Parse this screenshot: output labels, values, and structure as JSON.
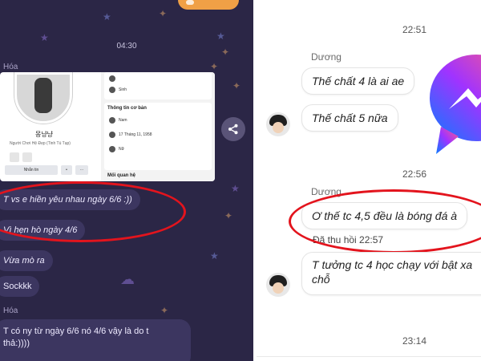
{
  "left_panel": {
    "timestamp": "04:30",
    "sender_top": "Hóa",
    "sender_bottom": "Hóa",
    "shared_card": {
      "name": "몽냥냥",
      "subtitle": "Người Chơi Hệ Đẹp (Tinh Tú Tạp)",
      "msg_button": "Nhắn tin",
      "side_label": "Sinh",
      "section_title": "Thông tin cơ bản",
      "rows": [
        "Nam",
        "17 Tháng 11, 1958",
        "Nữ"
      ],
      "section_more": "Mối quan hệ"
    },
    "messages": [
      "T vs e hiền yêu nhau ngày 6/6 :))",
      "Vì hẹn hò ngày 4/6",
      "Vừa mò ra",
      "Sockkk",
      "T có ny từ ngày 6/6 nó 4/6 vậy là do t",
      "thả:))))"
    ],
    "share_icon": "share-icon",
    "colors": {
      "background": "#2b2646",
      "bubble": "#3c3660",
      "annotation": "#e3141d"
    }
  },
  "right_panel": {
    "timestamps": [
      "22:51",
      "22:56",
      "23:14"
    ],
    "sender": "Dương",
    "messages": [
      "Thế chất 4 là ai ae",
      "Thế chất 5 nữa",
      "Ơ thế tc 4,5 đều là bóng đá à",
      "T tưởng tc 4 học chạy với bật xa",
      "chỗ"
    ],
    "recall_notice": "Đã thu hồi 22:57",
    "logo": "messenger-logo",
    "colors": {
      "background": "#ffffff",
      "annotation": "#e3141d"
    }
  }
}
